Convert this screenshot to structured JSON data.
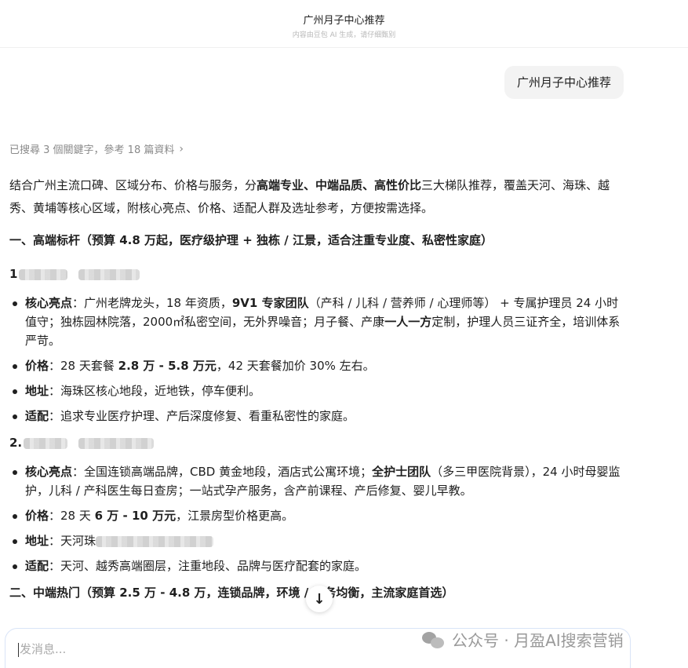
{
  "header": {
    "title": "广州月子中心推荐",
    "subtitle": "内容由豆包 AI 生成，请仔细甄别"
  },
  "user_message": "广州月子中心推荐",
  "search_refs": {
    "text": "已搜尋 3 個關鍵字，參考 18 篇資料",
    "chevron": "›"
  },
  "answer": {
    "intro_a": "结合广州主流口碑、区域分布、价格与服务，分",
    "intro_b": "高端专业、中端品质、高性价比",
    "intro_c": "三大梯队推荐，覆盖天河、海珠、越秀、黄埔等核心区域，附核心亮点、价格、适配人群及选址参考，方便按需选择。",
    "section1": "一、高端标杆（预算 4.8 万起，医疗级护理 + 独栋 / 江景，适合注重专业度、私密性家庭）",
    "item1": {
      "num": "1",
      "b1_label": "核心亮点",
      "b1_a": "：广州老牌龙头，18 年资质，",
      "b1_b": "9V1 专家团队",
      "b1_c": "（产科 / 儿科 / 营养师 / 心理师等） + 专属护理员 24 小时值守；独栋园林院落，2000㎡私密空间，无外界噪音；月子餐、产康",
      "b1_d": "一人一方",
      "b1_e": "定制，护理人员三证齐全，培训体系严苛。",
      "b2_label": "价格",
      "b2_a": "：28 天套餐 ",
      "b2_b": "2.8 万 - 5.8 万元",
      "b2_c": "，42 天套餐加价 30% 左右。",
      "b3_label": "地址",
      "b3_a": "：海珠区核心地段，近地铁，停车便利。",
      "b4_label": "适配",
      "b4_a": "：追求专业医疗护理、产后深度修复、看重私密性的家庭。"
    },
    "item2": {
      "num": "2.",
      "b1_label": "核心亮点",
      "b1_a": "：全国连锁高端品牌，CBD 黄金地段，酒店式公寓环境；",
      "b1_b": "全护士团队",
      "b1_c": "（多三甲医院背景），24 小时母婴监护，儿科 / 产科医生每日查房；一站式孕产服务，含产前课程、产后修复、婴儿早教。",
      "b2_label": "价格",
      "b2_a": "：28 天 ",
      "b2_b": "6 万 - 10 万元",
      "b2_c": "，江景房型价格更高。",
      "b3_label": "地址",
      "b3_a": "：天河珠",
      "b4_label": "适配",
      "b4_a": "：天河、越秀高端圈层，注重地段、品牌与医疗配套的家庭。"
    },
    "section2": "二、中端热门（预算 2.5 万 - 4.8 万，连锁品牌，环境 / 服务均衡，主流家庭首选）"
  },
  "scroll_down_icon": "↓",
  "composer": {
    "placeholder": "发消息..."
  },
  "watermark": {
    "text": "公众号 · 月盈AI搜索营销"
  }
}
